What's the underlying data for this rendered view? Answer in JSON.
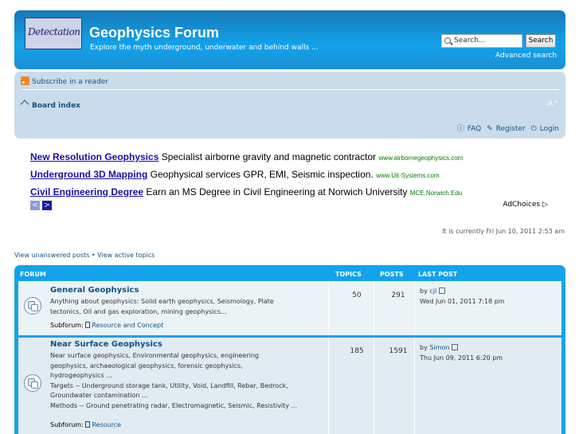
{
  "header": {
    "logo_text": "Detectation",
    "title": "Geophysics Forum",
    "description": "Explore the myth underground, underwater and behind walls ...",
    "search_placeholder": "Search...",
    "search_button": "Search",
    "advanced_search": "Advanced search",
    "accent": "#12a3eb"
  },
  "navbar": {
    "subscribe": "Subscribe in a reader",
    "board_index": "Board index",
    "font_size": "-A^",
    "faq": "FAQ",
    "register": "Register",
    "login": "Login"
  },
  "ads": {
    "items": [
      {
        "title": "New Resolution Geophysics",
        "text": " Specialist airborne gravity and magnetic contractor ",
        "url": "www.airbornegeophysics.com"
      },
      {
        "title": "Underground 3D Mapping",
        "text": " Geophysical services GPR, EMI, Seismic inspection. ",
        "url": "www.Uit-Systems.com"
      },
      {
        "title": "Civil Engineering Degree",
        "text": " Earn an MS Degree in Civil Engineering at Norwich University ",
        "url": "MCE.Norwich.Edu"
      }
    ],
    "prev": "<",
    "next": ">",
    "adchoices": "AdChoices ▷"
  },
  "current_time": "It is currently Fri Jun 10, 2011 2:53 am",
  "quick_links": "View unanswered posts • View active topics",
  "table": {
    "headers": {
      "forum": "Forum",
      "topics": "Topics",
      "posts": "Posts",
      "last_post": "Last post"
    },
    "rows": [
      {
        "name": "General Geophysics",
        "desc_lines": [
          "Anything about geophysics: Solid earth geophysics, Seismology, Plate",
          "tectonics, Oil and gas exploration, mining geophysics..."
        ],
        "subforum_label": "Subforum:",
        "subforum": "Resource and Concept",
        "topics": "50",
        "posts": "291",
        "by": "by",
        "user": "cjl",
        "date": "Wed Jun 01, 2011 7:18 pm"
      },
      {
        "name": "Near Surface Geophysics",
        "desc_lines": [
          "Near surface geophysics, Environmental geophysics, engineering",
          "geophysics, archaeological geophysics, forensic geophysics,",
          "hydrogeophysics ...",
          "Targets -- Underground storage tank, Utility, Void, Landfill, Rebar, Bedrock,",
          "Groundwater contamination ...",
          "Methods -- Ground penetrating radar, Electromagnetic, Seismic, Resistivity ..."
        ],
        "subforum_label": "Subforum:",
        "subforum": "Resource",
        "topics": "185",
        "posts": "1591",
        "by": "by",
        "user": "Simon",
        "date": "Thu Jun 09, 2011 6:20 pm"
      }
    ]
  }
}
